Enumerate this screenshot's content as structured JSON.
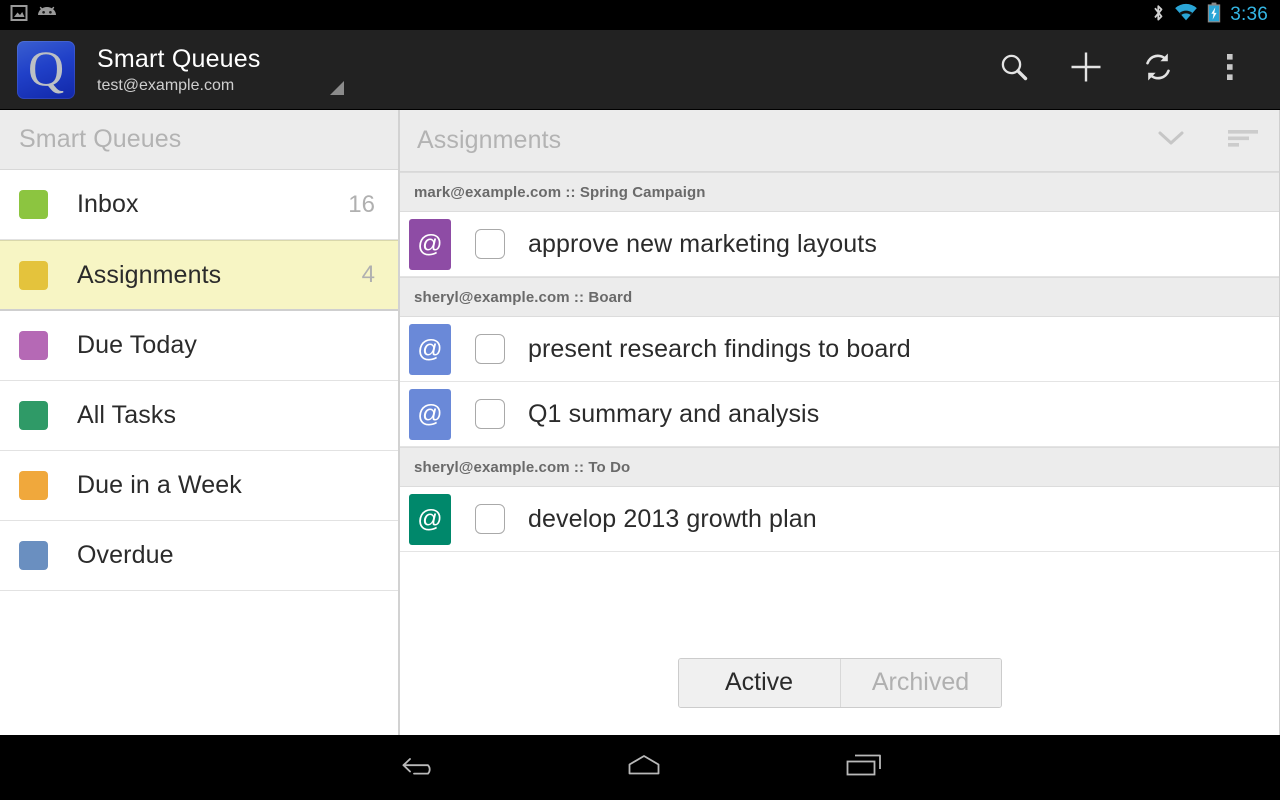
{
  "status_bar": {
    "left_icons": [
      "screenshot-icon",
      "android-robot-icon"
    ],
    "right_icons": [
      "bluetooth-icon",
      "wifi-icon",
      "battery-charging-icon"
    ],
    "clock": "3:36",
    "clock_color": "#34b6e4"
  },
  "action_bar": {
    "app_icon": "app-logo-q-icon",
    "title": "Smart Queues",
    "subtitle": "test@example.com",
    "spinner_icon": "spinner-triangle-icon",
    "actions": [
      {
        "name": "search-icon",
        "label": "Search"
      },
      {
        "name": "add-icon",
        "label": "Add"
      },
      {
        "name": "refresh-icon",
        "label": "Refresh"
      },
      {
        "name": "overflow-menu-icon",
        "label": "More options"
      }
    ]
  },
  "sidebar": {
    "header": "Smart Queues",
    "items": [
      {
        "label": "Inbox",
        "count": "16",
        "color": "#8cc540",
        "selected": false
      },
      {
        "label": "Assignments",
        "count": "4",
        "color": "#e4c33c",
        "selected": true
      },
      {
        "label": "Due Today",
        "count": "",
        "color": "#b569b5",
        "selected": false
      },
      {
        "label": "All Tasks",
        "count": "",
        "color": "#2f9a67",
        "selected": false
      },
      {
        "label": "Due in a Week",
        "count": "",
        "color": "#f0a83c",
        "selected": false
      },
      {
        "label": "Overdue",
        "count": "",
        "color": "#6a8fc0",
        "selected": false
      }
    ]
  },
  "panel": {
    "title": "Assignments",
    "header_actions": [
      {
        "name": "chevron-down-icon",
        "label": "Expand"
      },
      {
        "name": "sort-icon",
        "label": "Sort"
      }
    ],
    "groups": [
      {
        "header": "mark@example.com :: Spring Campaign",
        "tasks": [
          {
            "badge": "@",
            "badge_color": "#8e4ca5",
            "title": "approve new marketing layouts",
            "checked": false
          }
        ]
      },
      {
        "header": "sheryl@example.com :: Board",
        "tasks": [
          {
            "badge": "@",
            "badge_color": "#6a89d8",
            "title": "present research findings to board",
            "checked": false
          },
          {
            "badge": "@",
            "badge_color": "#6a89d8",
            "title": "Q1 summary and analysis",
            "checked": false
          }
        ]
      },
      {
        "header": "sheryl@example.com :: To Do",
        "tasks": [
          {
            "badge": "@",
            "badge_color": "#00886b",
            "title": "develop 2013 growth plan",
            "checked": false
          }
        ]
      }
    ],
    "footer": {
      "active_label": "Active",
      "archived_label": "Archived",
      "selected": "Active"
    }
  },
  "nav_bar": {
    "buttons": [
      {
        "name": "nav-back-icon",
        "label": "Back"
      },
      {
        "name": "nav-home-icon",
        "label": "Home"
      },
      {
        "name": "nav-recents-icon",
        "label": "Recent apps"
      }
    ]
  }
}
